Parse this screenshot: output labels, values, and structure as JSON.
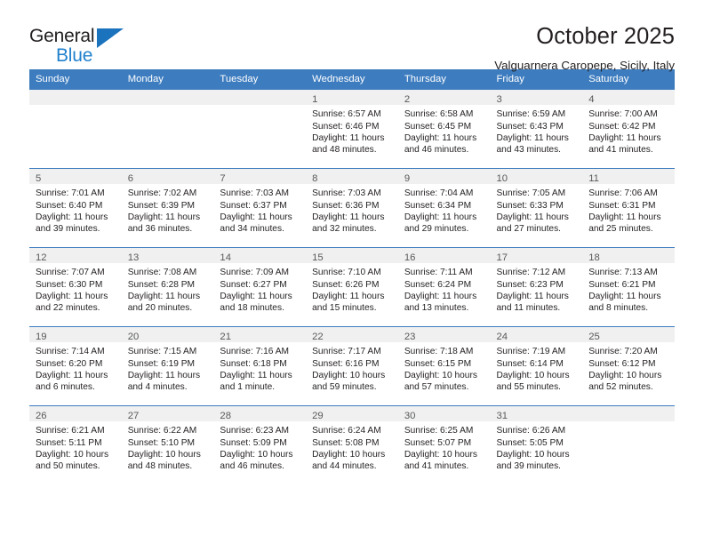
{
  "brand": {
    "name_top": "General",
    "name_bottom": "Blue",
    "triangle_color": "#1b72bd",
    "text_color": "#2081cd"
  },
  "header": {
    "title": "October 2025",
    "location": "Valguarnera Caropepe, Sicily, Italy"
  },
  "theme": {
    "header_blue": "#3d7cbf",
    "datebar_gray": "#f0f0f0",
    "text_dark": "#231f20",
    "date_number_gray": "#58595b"
  },
  "weekdays": [
    "Sunday",
    "Monday",
    "Tuesday",
    "Wednesday",
    "Thursday",
    "Friday",
    "Saturday"
  ],
  "weeks": [
    [
      {
        "day": "",
        "lines": []
      },
      {
        "day": "",
        "lines": []
      },
      {
        "day": "",
        "lines": []
      },
      {
        "day": "1",
        "lines": [
          "Sunrise: 6:57 AM",
          "Sunset: 6:46 PM",
          "Daylight: 11 hours",
          "and 48 minutes."
        ]
      },
      {
        "day": "2",
        "lines": [
          "Sunrise: 6:58 AM",
          "Sunset: 6:45 PM",
          "Daylight: 11 hours",
          "and 46 minutes."
        ]
      },
      {
        "day": "3",
        "lines": [
          "Sunrise: 6:59 AM",
          "Sunset: 6:43 PM",
          "Daylight: 11 hours",
          "and 43 minutes."
        ]
      },
      {
        "day": "4",
        "lines": [
          "Sunrise: 7:00 AM",
          "Sunset: 6:42 PM",
          "Daylight: 11 hours",
          "and 41 minutes."
        ]
      }
    ],
    [
      {
        "day": "5",
        "lines": [
          "Sunrise: 7:01 AM",
          "Sunset: 6:40 PM",
          "Daylight: 11 hours",
          "and 39 minutes."
        ]
      },
      {
        "day": "6",
        "lines": [
          "Sunrise: 7:02 AM",
          "Sunset: 6:39 PM",
          "Daylight: 11 hours",
          "and 36 minutes."
        ]
      },
      {
        "day": "7",
        "lines": [
          "Sunrise: 7:03 AM",
          "Sunset: 6:37 PM",
          "Daylight: 11 hours",
          "and 34 minutes."
        ]
      },
      {
        "day": "8",
        "lines": [
          "Sunrise: 7:03 AM",
          "Sunset: 6:36 PM",
          "Daylight: 11 hours",
          "and 32 minutes."
        ]
      },
      {
        "day": "9",
        "lines": [
          "Sunrise: 7:04 AM",
          "Sunset: 6:34 PM",
          "Daylight: 11 hours",
          "and 29 minutes."
        ]
      },
      {
        "day": "10",
        "lines": [
          "Sunrise: 7:05 AM",
          "Sunset: 6:33 PM",
          "Daylight: 11 hours",
          "and 27 minutes."
        ]
      },
      {
        "day": "11",
        "lines": [
          "Sunrise: 7:06 AM",
          "Sunset: 6:31 PM",
          "Daylight: 11 hours",
          "and 25 minutes."
        ]
      }
    ],
    [
      {
        "day": "12",
        "lines": [
          "Sunrise: 7:07 AM",
          "Sunset: 6:30 PM",
          "Daylight: 11 hours",
          "and 22 minutes."
        ]
      },
      {
        "day": "13",
        "lines": [
          "Sunrise: 7:08 AM",
          "Sunset: 6:28 PM",
          "Daylight: 11 hours",
          "and 20 minutes."
        ]
      },
      {
        "day": "14",
        "lines": [
          "Sunrise: 7:09 AM",
          "Sunset: 6:27 PM",
          "Daylight: 11 hours",
          "and 18 minutes."
        ]
      },
      {
        "day": "15",
        "lines": [
          "Sunrise: 7:10 AM",
          "Sunset: 6:26 PM",
          "Daylight: 11 hours",
          "and 15 minutes."
        ]
      },
      {
        "day": "16",
        "lines": [
          "Sunrise: 7:11 AM",
          "Sunset: 6:24 PM",
          "Daylight: 11 hours",
          "and 13 minutes."
        ]
      },
      {
        "day": "17",
        "lines": [
          "Sunrise: 7:12 AM",
          "Sunset: 6:23 PM",
          "Daylight: 11 hours",
          "and 11 minutes."
        ]
      },
      {
        "day": "18",
        "lines": [
          "Sunrise: 7:13 AM",
          "Sunset: 6:21 PM",
          "Daylight: 11 hours",
          "and 8 minutes."
        ]
      }
    ],
    [
      {
        "day": "19",
        "lines": [
          "Sunrise: 7:14 AM",
          "Sunset: 6:20 PM",
          "Daylight: 11 hours",
          "and 6 minutes."
        ]
      },
      {
        "day": "20",
        "lines": [
          "Sunrise: 7:15 AM",
          "Sunset: 6:19 PM",
          "Daylight: 11 hours",
          "and 4 minutes."
        ]
      },
      {
        "day": "21",
        "lines": [
          "Sunrise: 7:16 AM",
          "Sunset: 6:18 PM",
          "Daylight: 11 hours",
          "and 1 minute."
        ]
      },
      {
        "day": "22",
        "lines": [
          "Sunrise: 7:17 AM",
          "Sunset: 6:16 PM",
          "Daylight: 10 hours",
          "and 59 minutes."
        ]
      },
      {
        "day": "23",
        "lines": [
          "Sunrise: 7:18 AM",
          "Sunset: 6:15 PM",
          "Daylight: 10 hours",
          "and 57 minutes."
        ]
      },
      {
        "day": "24",
        "lines": [
          "Sunrise: 7:19 AM",
          "Sunset: 6:14 PM",
          "Daylight: 10 hours",
          "and 55 minutes."
        ]
      },
      {
        "day": "25",
        "lines": [
          "Sunrise: 7:20 AM",
          "Sunset: 6:12 PM",
          "Daylight: 10 hours",
          "and 52 minutes."
        ]
      }
    ],
    [
      {
        "day": "26",
        "lines": [
          "Sunrise: 6:21 AM",
          "Sunset: 5:11 PM",
          "Daylight: 10 hours",
          "and 50 minutes."
        ]
      },
      {
        "day": "27",
        "lines": [
          "Sunrise: 6:22 AM",
          "Sunset: 5:10 PM",
          "Daylight: 10 hours",
          "and 48 minutes."
        ]
      },
      {
        "day": "28",
        "lines": [
          "Sunrise: 6:23 AM",
          "Sunset: 5:09 PM",
          "Daylight: 10 hours",
          "and 46 minutes."
        ]
      },
      {
        "day": "29",
        "lines": [
          "Sunrise: 6:24 AM",
          "Sunset: 5:08 PM",
          "Daylight: 10 hours",
          "and 44 minutes."
        ]
      },
      {
        "day": "30",
        "lines": [
          "Sunrise: 6:25 AM",
          "Sunset: 5:07 PM",
          "Daylight: 10 hours",
          "and 41 minutes."
        ]
      },
      {
        "day": "31",
        "lines": [
          "Sunrise: 6:26 AM",
          "Sunset: 5:05 PM",
          "Daylight: 10 hours",
          "and 39 minutes."
        ]
      },
      {
        "day": "",
        "lines": []
      }
    ]
  ]
}
